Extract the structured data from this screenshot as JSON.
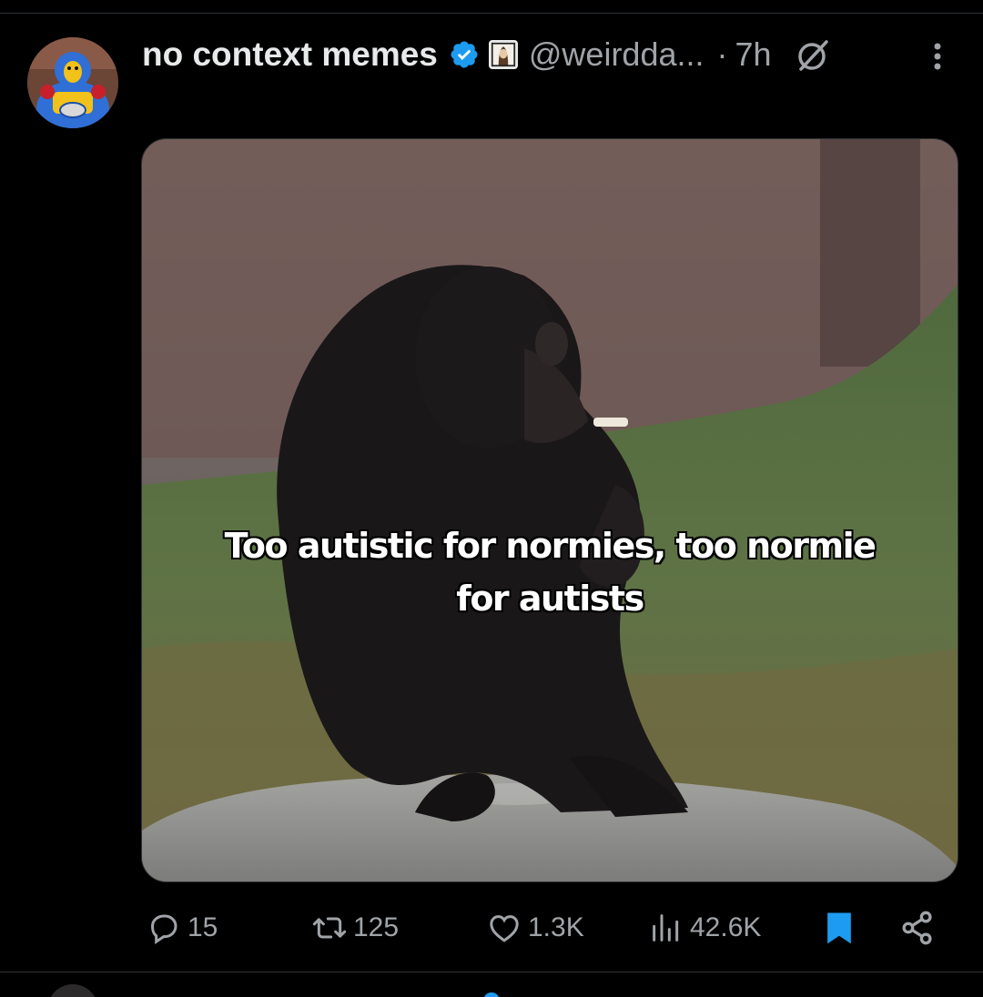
{
  "tweet": {
    "display_name": "no context memes",
    "handle": "@weirdda...",
    "separator": "·",
    "time": "7h",
    "media": {
      "caption_line1": "Too autistic for normies, too normie",
      "caption_line2": "for autists"
    },
    "actions": {
      "replies": "15",
      "reposts": "125",
      "likes": "1.3K",
      "views": "42.6K"
    }
  },
  "icons": {
    "verified": "verified-badge-icon",
    "affiliate": "affiliate-badge-icon",
    "grok": "grok-icon",
    "more": "more-vertical-icon",
    "reply": "reply-icon",
    "repost": "repost-icon",
    "like": "heart-icon",
    "views": "views-icon",
    "bookmark": "bookmark-icon",
    "share": "share-icon"
  },
  "colors": {
    "background": "#000000",
    "text_primary": "#e7e9ea",
    "text_secondary": "#a0a4a8",
    "accent": "#1d9bf0",
    "divider": "#2f3336"
  }
}
